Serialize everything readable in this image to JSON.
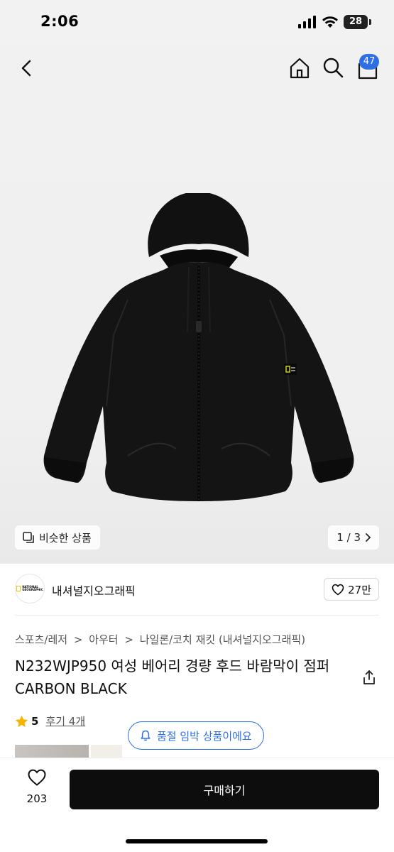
{
  "status_bar": {
    "time": "2:06",
    "battery": "28"
  },
  "header": {
    "cart_badge": "47"
  },
  "gallery": {
    "similar_label": "비슷한 상품",
    "page_indicator": "1 / 3"
  },
  "store": {
    "name": "내셔널지오그래픽",
    "follow_count": "27만",
    "logo_text": "NATIONAL GEOGRAPHIC"
  },
  "product": {
    "breadcrumb": [
      "스포츠/레저",
      "아우터",
      "나일론/코치 재킷 (내셔널지오그래픽)"
    ],
    "breadcrumb_separator": ">",
    "title": "N232WJP950 여성 베어리 경량 후드 바람막이 점퍼 CARBON BLACK",
    "rating": "5",
    "reviews_label": "후기 4개",
    "soldout_notice": "품절 임박 상품이에요"
  },
  "bottom_bar": {
    "like_count": "203",
    "buy_label": "구매하기"
  },
  "colors": {
    "accent": "#2f6fe4",
    "buy_button": "#0d0d0d",
    "star": "#f4b400"
  },
  "icons": [
    "back-icon",
    "home-icon",
    "search-icon",
    "cart-icon",
    "similar-icon",
    "chevron-right-icon",
    "heart-icon",
    "share-icon",
    "star-icon",
    "bell-icon"
  ]
}
